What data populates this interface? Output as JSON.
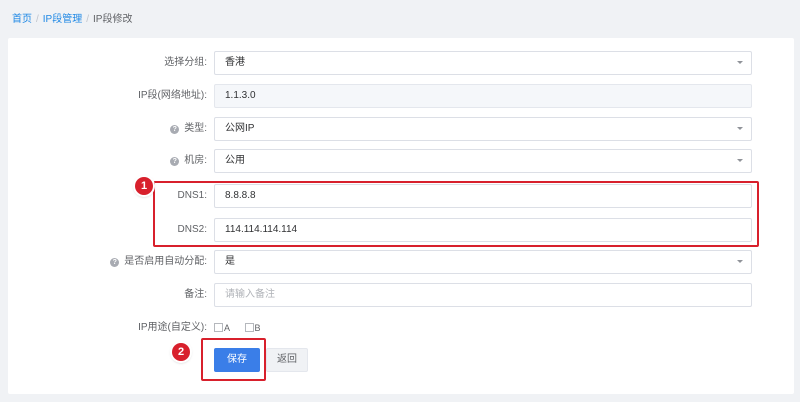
{
  "breadcrumb": {
    "items": [
      "首页",
      "IP段管理"
    ],
    "current": "IP段修改",
    "separator": "/"
  },
  "form": {
    "group": {
      "label": "选择分组:",
      "value": "香港"
    },
    "ip_segment": {
      "label": "IP段(网络地址):",
      "value": "1.1.3.0"
    },
    "type": {
      "label": "类型:",
      "value": "公网IP"
    },
    "room": {
      "label": "机房:",
      "value": "公用"
    },
    "dns1": {
      "label": "DNS1:",
      "value": "8.8.8.8"
    },
    "dns2": {
      "label": "DNS2:",
      "value": "114.114.114.114"
    },
    "auto_assign": {
      "label": "是否启用自动分配:",
      "value": "是"
    },
    "remark": {
      "label": "备注:",
      "placeholder": "请输入备注"
    },
    "ip_usage": {
      "label": "IP用途(自定义):",
      "options": [
        "A",
        "B"
      ]
    }
  },
  "actions": {
    "save_label": "保存",
    "back_label": "返回"
  },
  "annotations": {
    "marker1": "1",
    "marker2": "2"
  },
  "icons": {
    "help": "help-circle-icon",
    "dropdown": "chevron-down-icon",
    "checkbox": "checkbox-icon"
  },
  "colors": {
    "accent": "#3a7ee8",
    "highlight": "#d8202c",
    "link": "#1e88e5"
  }
}
